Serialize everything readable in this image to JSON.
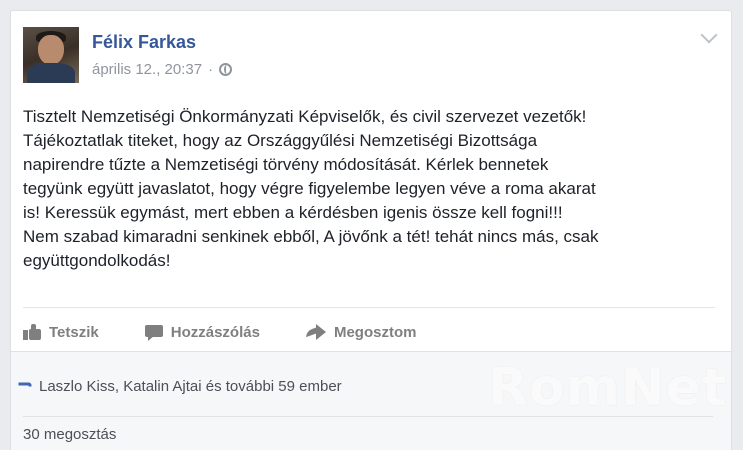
{
  "post": {
    "author": "Félix Farkas",
    "timestamp": "április 12., 20:37",
    "separator": "·",
    "privacy_icon": "globe-icon",
    "menu_icon": "chevron-down-icon",
    "text": "Tisztelt Nemzetiségi Önkormányzati Képviselők, és civil szervezet vezetők!\nTájékoztatlak titeket, hogy az Országgyűlési Nemzetiségi Bizottsága\nnapirendre tűzte a Nemzetiségi törvény módosítását. Kérlek bennetek\ntegyünk együtt javaslatot, hogy végre figyelembe legyen véve a roma akarat\nis! Keressük egymást, mert ebben a kérdésben igenis össze kell fogni!!!\nNem szabad kimaradni senkinek ebből, A jövőnk a tét! tehát nincs más, csak\negyüttgondolkodás!"
  },
  "actions": {
    "like_label": "Tetszik",
    "comment_label": "Hozzászólás",
    "share_label": "Megosztom"
  },
  "footer": {
    "reactions_text": "Laszlo Kiss, Katalin Ajtai és további 59 ember",
    "shares_text": "30 megosztás"
  },
  "watermark": "RomNet",
  "colors": {
    "author_link": "#365899",
    "meta_gray": "#90949c",
    "action_gray": "#7f7f7f",
    "like_blue": "#4267b2"
  }
}
